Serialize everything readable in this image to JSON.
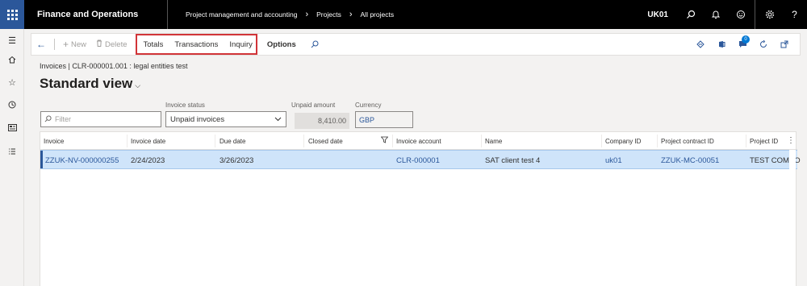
{
  "topbar": {
    "app_title": "Finance and Operations",
    "breadcrumbs": [
      "Project management and accounting",
      "Projects",
      "All projects"
    ],
    "company": "UK01",
    "icons": [
      "search-icon",
      "bell-icon",
      "smiley-icon",
      "gear-icon",
      "help-icon"
    ]
  },
  "leftrail": {
    "icons": [
      "hamburger-icon",
      "home-icon",
      "star-icon",
      "clock-icon",
      "workspace-icon",
      "list-icon"
    ]
  },
  "actionpane": {
    "back_icon": "back-arrow-icon",
    "new_label": "New",
    "delete_label": "Delete",
    "totals_label": "Totals",
    "transactions_label": "Transactions",
    "inquiry_label": "Inquiry",
    "options_label": "Options",
    "search_icon": "search-icon",
    "right_icons": [
      "diamond-icon",
      "office-icon",
      "chat-icon",
      "refresh-icon",
      "popout-icon"
    ],
    "badge_count": "0"
  },
  "page": {
    "breadcrumb": "Invoices  |  CLR-000001.001 : legal entities test",
    "view_title": "Standard view"
  },
  "filters": {
    "filter_placeholder": "Filter",
    "invoice_status_label": "Invoice status",
    "invoice_status_value": "Unpaid invoices",
    "unpaid_amount_label": "Unpaid amount",
    "unpaid_amount_value": "8,410.00",
    "currency_label": "Currency",
    "currency_value": "GBP"
  },
  "grid": {
    "columns": [
      "Invoice",
      "Invoice date",
      "Due date",
      "Closed date",
      "Invoice account",
      "Name",
      "Company ID",
      "Project contract ID",
      "Project ID"
    ],
    "rows": [
      {
        "invoice": "ZZUK-NV-000000255",
        "invoice_date": "2/24/2023",
        "due_date": "3/26/2023",
        "closed_date": "",
        "invoice_account": "CLR-000001",
        "name": "SAT client test 4",
        "company_id": "uk01",
        "project_contract_id": "ZZUK-MC-00051",
        "project_id": "TEST COMPO"
      }
    ]
  },
  "colors": {
    "topbar": "#000000",
    "waffle": "#2b579a",
    "highlight": "#d13438",
    "selected_row": "#cfe4fa",
    "link": "#2b579a"
  }
}
